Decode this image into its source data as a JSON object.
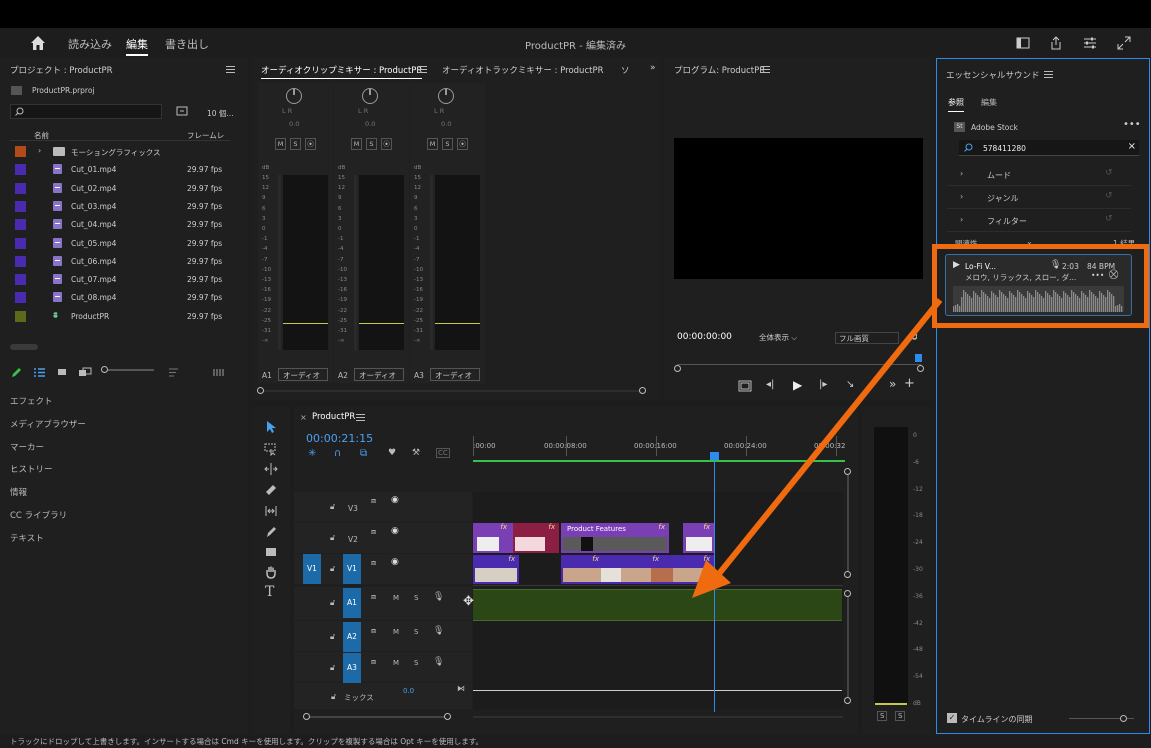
{
  "header": {
    "tabs": [
      "読み込み",
      "編集",
      "書き出し"
    ],
    "active_tab": "編集",
    "title": "ProductPR - 編集済み"
  },
  "project": {
    "title": "プロジェクト : ProductPR",
    "filename": "ProductPR.prproj",
    "item_count": "10 個...",
    "col_name": "名前",
    "col_fps": "フレームレ",
    "rows": [
      {
        "name": "モーショングラフィックス",
        "fps": "",
        "color": "#b24a1a",
        "kind": "folder"
      },
      {
        "name": "Cut_01.mp4",
        "fps": "29.97 fps",
        "color": "#4a2bb0",
        "kind": "clip"
      },
      {
        "name": "Cut_02.mp4",
        "fps": "29.97 fps",
        "color": "#4a2bb0",
        "kind": "clip"
      },
      {
        "name": "Cut_03.mp4",
        "fps": "29.97 fps",
        "color": "#4a2bb0",
        "kind": "clip"
      },
      {
        "name": "Cut_04.mp4",
        "fps": "29.97 fps",
        "color": "#4a2bb0",
        "kind": "clip"
      },
      {
        "name": "Cut_05.mp4",
        "fps": "29.97 fps",
        "color": "#4a2bb0",
        "kind": "clip"
      },
      {
        "name": "Cut_06.mp4",
        "fps": "29.97 fps",
        "color": "#4a2bb0",
        "kind": "clip"
      },
      {
        "name": "Cut_07.mp4",
        "fps": "29.97 fps",
        "color": "#4a2bb0",
        "kind": "clip"
      },
      {
        "name": "Cut_08.mp4",
        "fps": "29.97 fps",
        "color": "#4a2bb0",
        "kind": "clip"
      },
      {
        "name": "ProductPR",
        "fps": "29.97 fps",
        "color": "#5a6a1a",
        "kind": "sequence"
      }
    ]
  },
  "side_panels": [
    "エフェクト",
    "メディアブラウザー",
    "マーカー",
    "ヒストリー",
    "情報",
    "CC ライブラリ",
    "テキスト"
  ],
  "mixer": {
    "tab1": "オーディオクリップミキサー : ProductPR",
    "tab2": "オーディオトラックミキサー : ProductPR",
    "tab3": "ソ",
    "lr": "L      R",
    "zero": "0.0",
    "buttons": [
      "M",
      "S",
      "⦿"
    ],
    "db_label": "dB",
    "db_scale": [
      "15",
      "12",
      "9",
      "6",
      "3",
      "0",
      "-1",
      "-4",
      "-7",
      "-10",
      "-13",
      "-16",
      "-19",
      "-22",
      "-25",
      "-31",
      "-∞"
    ],
    "channels": [
      {
        "label": "A1",
        "name": "オーディオ"
      },
      {
        "label": "A2",
        "name": "オーディオ"
      },
      {
        "label": "A3",
        "name": "オーディオ"
      }
    ]
  },
  "program": {
    "title": "プログラム: ProductPR",
    "timecode": "00:00:00:00",
    "zoom": "全体表示",
    "quality": "フル画質"
  },
  "timeline": {
    "tab": "ProductPR",
    "timecode": "00:00:21:15",
    "ruler": [
      ":00:00",
      "00:00:08:00",
      "00:00:16:00",
      "00:00:24:00",
      "00:00:32"
    ],
    "video_tracks": [
      "V3",
      "V2",
      "V1"
    ],
    "audio_tracks": [
      "A1",
      "A2",
      "A3"
    ],
    "source_v": "V1",
    "mix_label": "ミックス",
    "mix_value": "0.0",
    "title_clip": "Product Features",
    "fx": "fx",
    "m": "M",
    "s": "S"
  },
  "meter_right": {
    "scale": [
      "0",
      "-6",
      "-12",
      "-18",
      "-24",
      "-30",
      "-36",
      "-42",
      "-48",
      "-54",
      "dB"
    ],
    "solo": [
      "S",
      "S"
    ]
  },
  "essential_sound": {
    "title": "エッセンシャルサウンド",
    "tabs": [
      "参照",
      "編集"
    ],
    "active_tab": "参照",
    "source": "Adobe Stock",
    "search_value": "578411280",
    "categories": [
      "ムード",
      "ジャンル",
      "フィルター"
    ],
    "sort_label": "関連性",
    "result_count": "1 結果",
    "result": {
      "title": "Lo-Fi V...",
      "duration": "2:03",
      "bpm": "84 BPM",
      "tags": "メロウ, リラックス, スロー, ダ..."
    },
    "sync_label": "タイムラインの同期",
    "sync_checked": true
  },
  "status": "トラックにドロップして上書きします。インサートする場合は Cmd キーを使用します。クリップを複製する場合は Opt キーを使用します。",
  "colors": {
    "accent_blue": "#2d8ceb",
    "annotation_orange": "#f06a10",
    "clip_purple": "#7a3fb5",
    "clip_crimson": "#8c1e44",
    "audio_green": "#2a4715",
    "track_blue": "#1d6aa8"
  }
}
